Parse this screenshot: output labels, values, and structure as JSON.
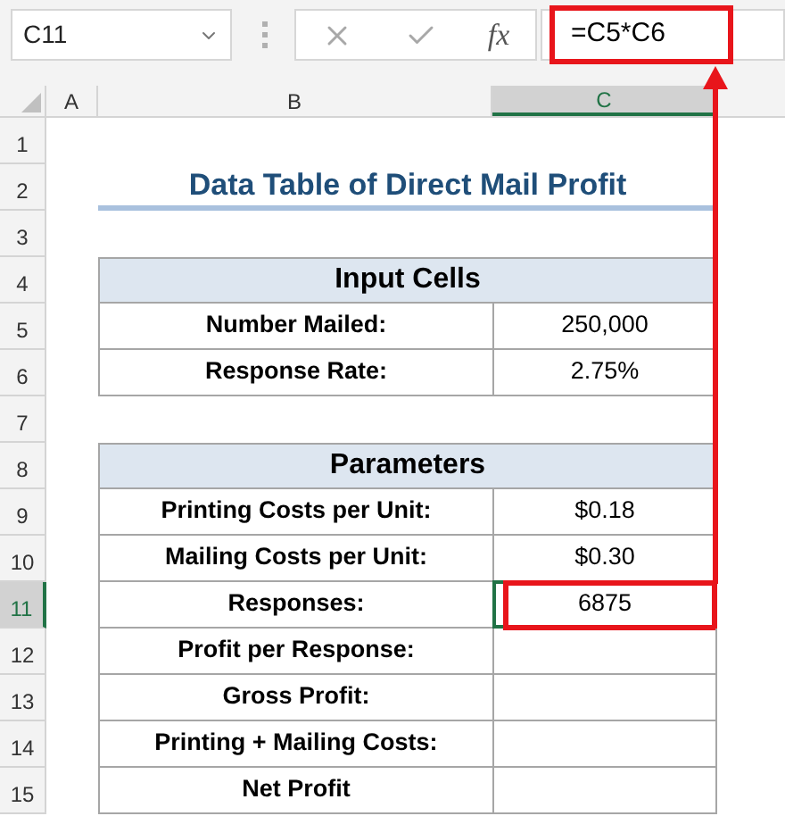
{
  "name_box": "C11",
  "function_label": "fx",
  "formula": {
    "text": "=C5*C6",
    "highlighted": true
  },
  "columns": [
    {
      "label": "A",
      "selected": false
    },
    {
      "label": "B",
      "selected": false
    },
    {
      "label": "C",
      "selected": true
    }
  ],
  "rows": [
    {
      "number": "1",
      "selected": false,
      "cells": []
    },
    {
      "number": "2",
      "selected": false,
      "cells": [
        {
          "kind": "title",
          "text": "Data Table of Direct Mail Profit"
        }
      ]
    },
    {
      "number": "3",
      "selected": false,
      "cells": []
    },
    {
      "number": "4",
      "selected": false,
      "cells": [
        {
          "kind": "header",
          "text": "Input Cells"
        }
      ]
    },
    {
      "number": "5",
      "selected": false,
      "cells": [
        {
          "kind": "label",
          "text": "Number Mailed:"
        },
        {
          "kind": "value",
          "text": "250,000",
          "highlighted": false
        }
      ]
    },
    {
      "number": "6",
      "selected": false,
      "cells": [
        {
          "kind": "label",
          "text": "Response Rate:"
        },
        {
          "kind": "value",
          "text": "2.75%",
          "highlighted": false
        }
      ]
    },
    {
      "number": "7",
      "selected": false,
      "cells": []
    },
    {
      "number": "8",
      "selected": false,
      "cells": [
        {
          "kind": "header",
          "text": "Parameters"
        }
      ]
    },
    {
      "number": "9",
      "selected": false,
      "cells": [
        {
          "kind": "label",
          "text": "Printing Costs per Unit:"
        },
        {
          "kind": "value",
          "text": "$0.18",
          "highlighted": false
        }
      ]
    },
    {
      "number": "10",
      "selected": false,
      "cells": [
        {
          "kind": "label",
          "text": "Mailing Costs per Unit:"
        },
        {
          "kind": "value",
          "text": "$0.30",
          "highlighted": false
        }
      ]
    },
    {
      "number": "11",
      "selected": true,
      "cells": [
        {
          "kind": "label",
          "text": "Responses:"
        },
        {
          "kind": "value",
          "text": "6875",
          "highlighted": true
        }
      ]
    },
    {
      "number": "12",
      "selected": false,
      "cells": [
        {
          "kind": "label",
          "text": "Profit per Response:"
        },
        {
          "kind": "value",
          "highlighted": false
        }
      ]
    },
    {
      "number": "13",
      "selected": false,
      "cells": [
        {
          "kind": "label",
          "text": "Gross Profit:"
        },
        {
          "kind": "value",
          "highlighted": false
        }
      ]
    },
    {
      "number": "14",
      "selected": false,
      "cells": [
        {
          "kind": "label",
          "text": "Printing + Mailing Costs:"
        },
        {
          "kind": "value",
          "highlighted": false
        }
      ]
    },
    {
      "number": "15",
      "selected": false,
      "cells": [
        {
          "kind": "label",
          "text": "Net Profit"
        },
        {
          "kind": "value",
          "highlighted": false
        }
      ]
    }
  ],
  "annotation_arrow": true
}
